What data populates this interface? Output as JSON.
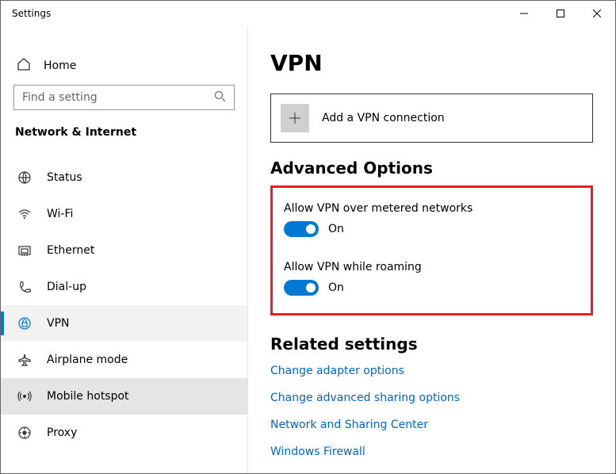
{
  "titlebar": {
    "title": "Settings"
  },
  "sidebar": {
    "home_label": "Home",
    "search_placeholder": "Find a setting",
    "category": "Network & Internet",
    "items": [
      {
        "label": "Status"
      },
      {
        "label": "Wi-Fi"
      },
      {
        "label": "Ethernet"
      },
      {
        "label": "Dial-up"
      },
      {
        "label": "VPN"
      },
      {
        "label": "Airplane mode"
      },
      {
        "label": "Mobile hotspot"
      },
      {
        "label": "Proxy"
      }
    ]
  },
  "main": {
    "title": "VPN",
    "add_label": "Add a VPN connection",
    "advanced_title": "Advanced Options",
    "options": [
      {
        "label": "Allow VPN over metered networks",
        "state": "On"
      },
      {
        "label": "Allow VPN while roaming",
        "state": "On"
      }
    ],
    "related_title": "Related settings",
    "related_links": [
      "Change adapter options",
      "Change advanced sharing options",
      "Network and Sharing Center",
      "Windows Firewall"
    ]
  }
}
